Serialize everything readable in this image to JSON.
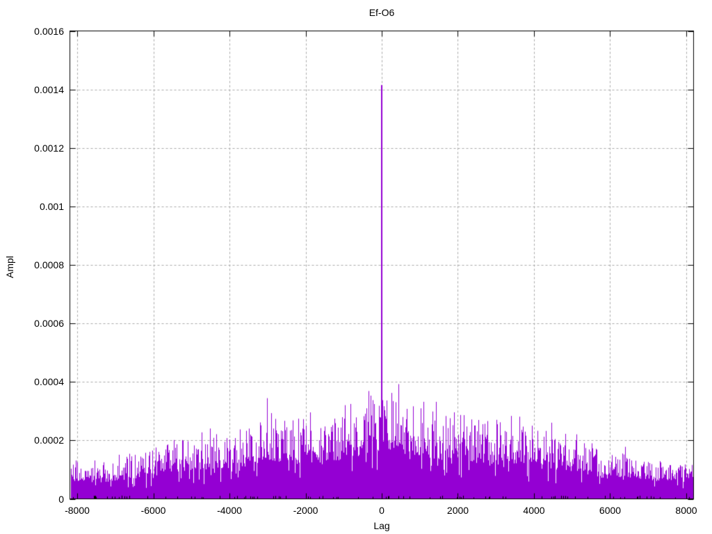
{
  "title": "Ef-O6",
  "chart_data": {
    "type": "impulses",
    "title": "Ef-O6",
    "xlabel": "Lag",
    "ylabel": "Ampl",
    "xlim": [
      -8192,
      8192
    ],
    "ylim": [
      0,
      0.0016
    ],
    "x_ticks": [
      -8000,
      -6000,
      -4000,
      -2000,
      0,
      2000,
      4000,
      6000,
      8000
    ],
    "x_tick_labels": [
      "-8000",
      "-6000",
      "-4000",
      "-2000",
      "0",
      "2000",
      "4000",
      "6000",
      "8000"
    ],
    "y_ticks": [
      0,
      0.0002,
      0.0004,
      0.0006,
      0.0008,
      0.001,
      0.0012,
      0.0014,
      0.0016
    ],
    "y_tick_labels": [
      "0",
      "0.0002",
      "0.0004",
      "0.0006",
      "0.0008",
      "0.001",
      "0.0012",
      "0.0014",
      "0.0016"
    ],
    "grid": true,
    "legend": "none",
    "line_color": "#9400d3",
    "grid_color": "#a8a8a8",
    "border_color": "#000000",
    "main_peak": {
      "lag": 0,
      "value": 0.001415
    },
    "noise_envelope": {
      "description": "approximate peak amplitude of noise impulses vs lag",
      "lags": [
        -8192,
        -8000,
        -7500,
        -7000,
        -6500,
        -6000,
        -5500,
        -5000,
        -4500,
        -4000,
        -3500,
        -3000,
        -2500,
        -2000,
        -1500,
        -1000,
        -500,
        0,
        500,
        1000,
        1500,
        2000,
        2500,
        3000,
        3500,
        4000,
        4500,
        5000,
        5500,
        6000,
        6500,
        7000,
        7500,
        8000,
        8192
      ],
      "peak_values": [
        0.00012,
        0.00013,
        0.00012,
        0.00014,
        0.00015,
        0.00017,
        0.0002,
        0.00022,
        0.00022,
        0.00023,
        0.00025,
        0.0003,
        0.00027,
        0.00028,
        0.00027,
        0.0003,
        0.00032,
        0.00037,
        0.00037,
        0.00032,
        0.0003,
        0.0003,
        0.00028,
        0.00026,
        0.00027,
        0.00025,
        0.00022,
        0.00021,
        0.00018,
        0.00015,
        0.00016,
        0.00013,
        0.00014,
        0.00012,
        0.00012
      ],
      "base_fraction": 0.45
    },
    "seed": 1337
  }
}
